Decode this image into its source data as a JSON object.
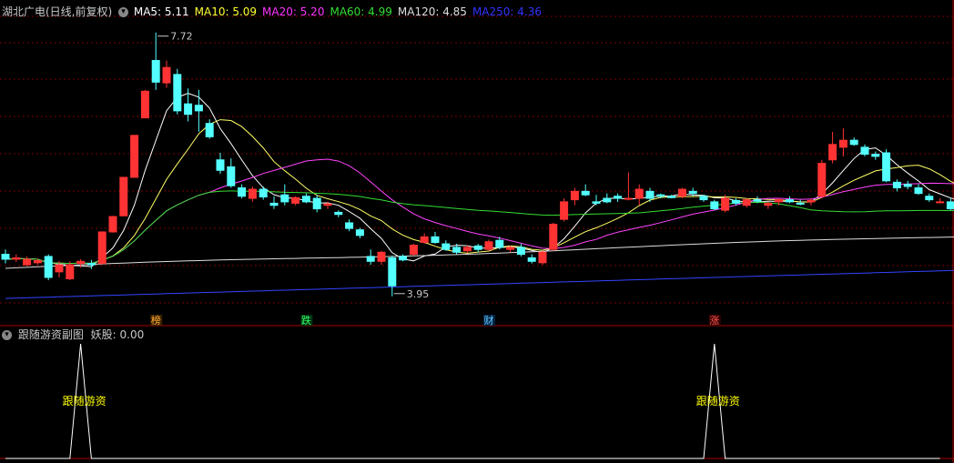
{
  "main_header": {
    "title": "湖北广电(日线,前复权)",
    "ma_labels": [
      {
        "text": "MA5: 5.11",
        "color": "#ffffff"
      },
      {
        "text": "MA10: 5.09",
        "color": "#ffff33"
      },
      {
        "text": "MA20: 5.20",
        "color": "#ff33ff"
      },
      {
        "text": "MA60: 4.99",
        "color": "#33dd33"
      },
      {
        "text": "MA120: 4.85",
        "color": "#dddddd"
      },
      {
        "text": "MA250: 4.36",
        "color": "#3333ff"
      }
    ]
  },
  "sub_header": {
    "title": "跟随游资副图",
    "value_text": "妖股: 0.00"
  },
  "price_labels": {
    "high": "7.72",
    "low": "3.95"
  },
  "event_tags": [
    {
      "text": "榜",
      "color": "#ffaa33",
      "bg": "#3a2200"
    },
    {
      "text": "跌",
      "color": "#33ff66",
      "bg": "#003311"
    },
    {
      "text": "财",
      "color": "#66ccff",
      "bg": "#002244"
    },
    {
      "text": "涨",
      "color": "#ff5555",
      "bg": "#330000"
    }
  ],
  "signal_labels": [
    "跟随游资",
    "跟随游资"
  ],
  "colors": {
    "up": "#ff3333",
    "down": "#54ffff",
    "grid": "#7a0000",
    "ma5": "#ffffff",
    "ma10": "#ffff66",
    "ma20": "#ff44ff",
    "ma60": "#33dd33",
    "ma120": "#dddddd",
    "ma250": "#3344ff",
    "signal_label": "#ffff00"
  },
  "chart_data": [
    {
      "type": "candlestick",
      "title": "湖北广电(日线,前复权)",
      "y_high": 7.72,
      "y_low": 3.95,
      "ylim": [
        3.7,
        7.95
      ],
      "candles": [
        [
          4.55,
          4.62,
          4.42,
          4.48
        ],
        [
          4.48,
          4.55,
          4.44,
          4.5
        ],
        [
          4.4,
          4.52,
          4.38,
          4.48
        ],
        [
          4.43,
          4.49,
          4.4,
          4.46
        ],
        [
          4.52,
          4.55,
          4.18,
          4.22
        ],
        [
          4.3,
          4.45,
          4.22,
          4.4
        ],
        [
          4.2,
          4.45,
          4.18,
          4.4
        ],
        [
          4.42,
          4.48,
          4.36,
          4.45
        ],
        [
          4.42,
          4.47,
          4.34,
          4.4
        ],
        [
          4.42,
          4.88,
          4.4,
          4.87
        ],
        [
          4.87,
          5.1,
          4.86,
          5.09
        ],
        [
          5.1,
          5.65,
          5.1,
          5.65
        ],
        [
          5.65,
          6.25,
          5.65,
          6.25
        ],
        [
          6.5,
          6.9,
          6.5,
          6.88
        ],
        [
          7.32,
          7.72,
          6.9,
          7.01
        ],
        [
          7.0,
          7.32,
          6.93,
          7.22
        ],
        [
          7.12,
          7.2,
          6.55,
          6.6
        ],
        [
          6.7,
          6.92,
          6.45,
          6.55
        ],
        [
          6.68,
          6.9,
          6.3,
          6.6
        ],
        [
          6.42,
          6.48,
          6.2,
          6.23
        ],
        [
          5.9,
          6.0,
          5.7,
          5.75
        ],
        [
          5.8,
          5.92,
          5.5,
          5.53
        ],
        [
          5.5,
          5.55,
          5.35,
          5.38
        ],
        [
          5.35,
          5.52,
          5.3,
          5.48
        ],
        [
          5.48,
          5.52,
          5.33,
          5.37
        ],
        [
          5.28,
          5.38,
          5.2,
          5.25
        ],
        [
          5.4,
          5.55,
          5.25,
          5.3
        ],
        [
          5.28,
          5.38,
          5.25,
          5.36
        ],
        [
          5.38,
          5.42,
          5.28,
          5.3
        ],
        [
          5.35,
          5.4,
          5.15,
          5.2
        ],
        [
          5.25,
          5.3,
          5.2,
          5.27
        ],
        [
          5.15,
          5.18,
          5.08,
          5.12
        ],
        [
          5.0,
          5.05,
          4.88,
          4.92
        ],
        [
          4.9,
          4.93,
          4.78,
          4.82
        ],
        [
          4.52,
          4.62,
          4.4,
          4.45
        ],
        [
          4.45,
          4.6,
          4.4,
          4.58
        ],
        [
          4.5,
          4.53,
          3.95,
          4.1
        ],
        [
          4.52,
          4.55,
          4.45,
          4.47
        ],
        [
          4.55,
          4.7,
          4.53,
          4.68
        ],
        [
          4.72,
          4.85,
          4.7,
          4.8
        ],
        [
          4.8,
          4.87,
          4.7,
          4.72
        ],
        [
          4.7,
          4.75,
          4.6,
          4.62
        ],
        [
          4.65,
          4.7,
          4.55,
          4.58
        ],
        [
          4.6,
          4.68,
          4.57,
          4.65
        ],
        [
          4.67,
          4.7,
          4.58,
          4.62
        ],
        [
          4.62,
          4.76,
          4.6,
          4.73
        ],
        [
          4.75,
          4.8,
          4.62,
          4.65
        ],
        [
          4.62,
          4.68,
          4.58,
          4.65
        ],
        [
          4.65,
          4.7,
          4.52,
          4.55
        ],
        [
          4.5,
          4.55,
          4.42,
          4.45
        ],
        [
          4.43,
          4.6,
          4.4,
          4.58
        ],
        [
          4.62,
          5.0,
          4.6,
          4.98
        ],
        [
          5.05,
          5.35,
          5.02,
          5.3
        ],
        [
          5.33,
          5.5,
          5.25,
          5.45
        ],
        [
          5.45,
          5.55,
          5.38,
          5.4
        ],
        [
          5.3,
          5.4,
          5.25,
          5.28
        ],
        [
          5.35,
          5.42,
          5.28,
          5.3
        ],
        [
          5.38,
          5.42,
          5.3,
          5.35
        ],
        [
          5.35,
          5.72,
          5.32,
          5.35
        ],
        [
          5.35,
          5.55,
          5.25,
          5.48
        ],
        [
          5.45,
          5.5,
          5.3,
          5.35
        ],
        [
          5.4,
          5.42,
          5.35,
          5.38
        ],
        [
          5.38,
          5.4,
          5.35,
          5.36
        ],
        [
          5.38,
          5.5,
          5.35,
          5.48
        ],
        [
          5.45,
          5.5,
          5.38,
          5.42
        ],
        [
          5.38,
          5.4,
          5.3,
          5.33
        ],
        [
          5.3,
          5.33,
          5.18,
          5.2
        ],
        [
          5.18,
          5.4,
          5.15,
          5.35
        ],
        [
          5.32,
          5.35,
          5.25,
          5.28
        ],
        [
          5.25,
          5.35,
          5.22,
          5.33
        ],
        [
          5.33,
          5.38,
          5.28,
          5.31
        ],
        [
          5.25,
          5.3,
          5.2,
          5.28
        ],
        [
          5.3,
          5.35,
          5.25,
          5.33
        ],
        [
          5.33,
          5.38,
          5.28,
          5.3
        ],
        [
          5.28,
          5.33,
          5.25,
          5.27
        ],
        [
          5.3,
          5.35,
          5.25,
          5.32
        ],
        [
          5.38,
          5.9,
          5.35,
          5.85
        ],
        [
          5.9,
          6.3,
          5.85,
          6.12
        ],
        [
          6.08,
          6.35,
          5.95,
          6.18
        ],
        [
          6.18,
          6.22,
          6.1,
          6.12
        ],
        [
          6.08,
          6.12,
          5.95,
          5.98
        ],
        [
          5.98,
          6.02,
          5.9,
          5.95
        ],
        [
          6.0,
          6.05,
          5.58,
          5.6
        ],
        [
          5.58,
          5.62,
          5.45,
          5.5
        ],
        [
          5.55,
          5.6,
          5.48,
          5.52
        ],
        [
          5.5,
          5.55,
          5.4,
          5.42
        ],
        [
          5.38,
          5.42,
          5.3,
          5.33
        ],
        [
          5.3,
          5.35,
          5.28,
          5.3
        ],
        [
          5.3,
          5.35,
          5.18,
          5.2
        ],
        [
          5.3,
          5.36,
          5.3,
          5.35
        ],
        [
          5.35,
          5.42,
          5.33,
          5.4
        ],
        [
          5.38,
          5.42,
          5.35,
          5.38
        ],
        [
          5.36,
          5.4,
          5.33,
          5.35
        ],
        [
          5.38,
          5.42,
          5.34,
          5.39
        ],
        [
          5.4,
          5.43,
          5.36,
          5.37
        ],
        [
          5.36,
          5.4,
          5.33,
          5.34
        ],
        [
          5.34,
          5.4,
          5.32,
          5.38
        ],
        [
          5.38,
          5.44,
          5.36,
          5.42
        ]
      ],
      "ma_values": {
        "MA5": 5.11,
        "MA10": 5.09,
        "MA20": 5.2,
        "MA60": 4.99,
        "MA120": 4.85,
        "MA250": 4.36
      },
      "ma10_trend": [
        4.55,
        4.5,
        4.46,
        4.45,
        4.45,
        4.46,
        4.5,
        4.6,
        4.85,
        5.2,
        5.6,
        6.0,
        6.3,
        6.6,
        6.75,
        6.7,
        6.5,
        6.2,
        5.95,
        5.75,
        5.6,
        5.5,
        5.4,
        5.3,
        5.2,
        5.1,
        5.0,
        4.85,
        4.72,
        4.62,
        4.6,
        4.62,
        4.66,
        4.68,
        4.7,
        4.68,
        4.65,
        4.63,
        4.62,
        4.62,
        4.62,
        4.7,
        4.82,
        4.95,
        5.07,
        5.2,
        5.28,
        5.33,
        5.35,
        5.35,
        5.33,
        5.32,
        5.31,
        5.3,
        5.3,
        5.32,
        5.4,
        5.55,
        5.72,
        5.85,
        5.85,
        5.75,
        5.62,
        5.48,
        5.38,
        5.33,
        5.33,
        5.34,
        5.36,
        5.37,
        5.38
      ]
    },
    {
      "type": "line",
      "title": "跟随游资副图",
      "series": [
        {
          "name": "妖股",
          "values": [
            0,
            0,
            0,
            0,
            0,
            0,
            0,
            1,
            0,
            0,
            0,
            0,
            0,
            0,
            0,
            0,
            0,
            0,
            0,
            0,
            0,
            0,
            0,
            0,
            0,
            0,
            0,
            0,
            0,
            0,
            0,
            0,
            0,
            0,
            0,
            0,
            0,
            0,
            0,
            0,
            0,
            0,
            0,
            0,
            0,
            0,
            0,
            0,
            0,
            0,
            0,
            0,
            0,
            0,
            0,
            0,
            0,
            0,
            0,
            0,
            0,
            0,
            0,
            0,
            0,
            0,
            1,
            0,
            0,
            0,
            0,
            0,
            0,
            0,
            0,
            0,
            0,
            0,
            0,
            0,
            0,
            0,
            0,
            0,
            0,
            0,
            0,
            0
          ]
        }
      ],
      "last_value": 0.0,
      "signal_label": "跟随游资"
    }
  ]
}
